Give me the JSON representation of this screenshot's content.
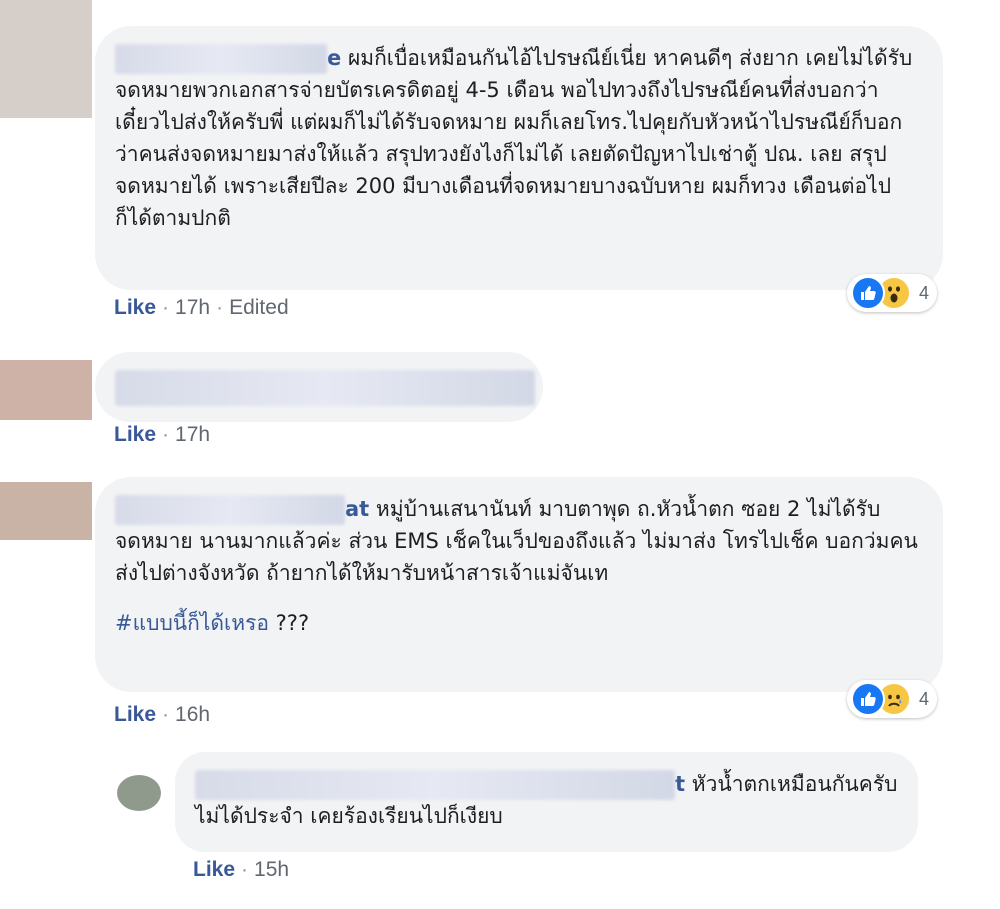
{
  "comments": [
    {
      "name_tail": "e",
      "text": "ผมก็เบื่อเหมือนกันไอ้ไปรษณีย์เนี่ย หาคนดีๆ ส่งยาก เคยไม่ได้รับจดหมายพวกเอกสารจ่ายบัตรเครดิตอยู่ 4-5 เดือน พอไปทวงถึงไปรษณีย์คนที่ส่งบอกว่าเดี๋ยวไปส่งให้ครับพี่ แต่ผมก็ไม่ได้รับจดหมาย ผมก็เลยโทร.ไปคุยกับหัวหน้าไปรษณีย์ก็บอกว่าคนส่งจดหมายมาส่งให้แล้ว สรุปทวงยังไงก็ไม่ได้ เลยตัดปัญหาไปเช่าตู้ ปณ. เลย สรุปจดหมายได้ เพราะเสียปีละ 200 มีบางเดือนที่จดหมายบางฉบับหาย ผมก็ทวง เดือนต่อไปก็ได้ตามปกติ",
      "reaction_count": "4",
      "like": "Like",
      "time": "17h",
      "edited": "Edited"
    },
    {
      "like": "Like",
      "time": "17h"
    },
    {
      "name_tail": "at",
      "text": "หมู่บ้านเสนานันท์ มาบตาพุด ถ.หัวน้ำตก ซอย 2 ไม่ได้รับจดหมาย นานมากแล้วค่ะ ส่วน EMS เช็คในเว็ปของถึงแล้ว ไม่มาส่ง โทรไปเช็ค บอกว่มคนส่งไปต่างจังหวัด ถ้ายากได้ให้มารับหน้าสารเจ้าแม่จันเท",
      "hashtag": "#แบบนี้ก็ได้เหรอ",
      "hashtag_suffix": " ???",
      "reaction_count": "4",
      "like": "Like",
      "time": "16h"
    },
    {
      "name_tail": "t",
      "text": "หัวน้ำตกเหมือนกันครับ ไม่ได้ประจำ เคยร้องเรียนไปก็เงียบ",
      "like": "Like",
      "time": "15h"
    }
  ],
  "colors": {
    "bubble": "#f2f3f5",
    "link": "#385898",
    "meta": "#606770",
    "like_reaction": "#1877f2",
    "emoji_reaction": "#f7c744"
  },
  "icons": [
    "like-reaction-icon",
    "wow-reaction-icon",
    "sad-reaction-icon"
  ]
}
